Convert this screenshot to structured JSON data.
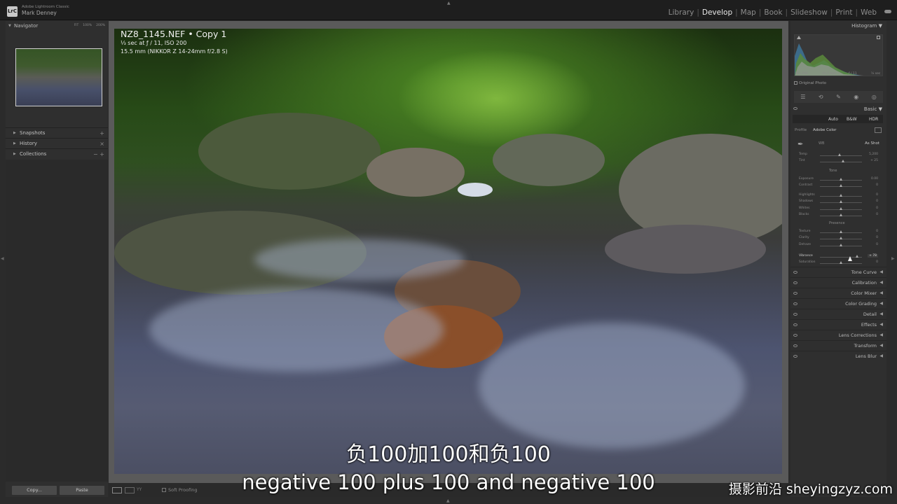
{
  "app": {
    "logo_text": "LrC",
    "app_name": "Adobe Lightroom Classic",
    "user_name": "Mark Denney"
  },
  "modules": [
    "Library",
    "Develop",
    "Map",
    "Book",
    "Slideshow",
    "Print",
    "Web"
  ],
  "active_module": "Develop",
  "left_panel": {
    "navigator": {
      "title": "Navigator",
      "zooms": [
        "FIT",
        "100%",
        "200%"
      ]
    },
    "sections": [
      {
        "label": "Snapshots",
        "control": "+"
      },
      {
        "label": "History",
        "control": "×"
      },
      {
        "label": "Collections",
        "control": "− +"
      }
    ],
    "copy_label": "Copy...",
    "paste_label": "Paste"
  },
  "photo_info": {
    "filename": "NZ8_1145.NEF  •  Copy 1",
    "exposure": "⅓ sec at ƒ / 11, ISO 200",
    "lens": "15.5 mm (NIKKOR Z 14-24mm f/2.8 S)"
  },
  "right_panel": {
    "histogram": {
      "title": "Histogram",
      "info": [
        "ISO 200",
        "15.5 mm",
        "ƒ / 11",
        "⅓ sec"
      ],
      "original_photo": "Original Photo"
    },
    "basic": {
      "title": "Basic",
      "treatments": [
        "Auto",
        "B&W",
        "HDR"
      ],
      "profile_label": "Profile",
      "profile_value": "Adobe Color",
      "wb_label": "WB",
      "wb_value": "As Shot",
      "tone_label": "Tone",
      "presence_label": "Presence",
      "sliders": [
        {
          "label": "Temp",
          "value": "5,200",
          "pos": 0.48
        },
        {
          "label": "Tint",
          "value": "+ 25",
          "pos": 0.55
        },
        {
          "label": "Exposure",
          "value": "0.00",
          "pos": 0.5
        },
        {
          "label": "Contrast",
          "value": "0",
          "pos": 0.5
        },
        {
          "label": "Highlights",
          "value": "0",
          "pos": 0.5
        },
        {
          "label": "Shadows",
          "value": "0",
          "pos": 0.5
        },
        {
          "label": "Whites",
          "value": "0",
          "pos": 0.5
        },
        {
          "label": "Blacks",
          "value": "0",
          "pos": 0.5
        },
        {
          "label": "Texture",
          "value": "0",
          "pos": 0.5
        },
        {
          "label": "Clarity",
          "value": "0",
          "pos": 0.5
        },
        {
          "label": "Dehaze",
          "value": "0",
          "pos": 0.5
        },
        {
          "label": "Vibrance",
          "value": "+ 78",
          "pos": 0.89
        },
        {
          "label": "Saturation",
          "value": "0",
          "pos": 0.5
        }
      ]
    },
    "sections": [
      "Tone Curve",
      "Calibration",
      "Color Mixer",
      "Color Grading",
      "Detail",
      "Effects",
      "Lens Corrections",
      "Transform",
      "Lens Blur"
    ]
  },
  "bottom_toolbar": {
    "view_label": "YY",
    "soft_proofing": "Soft Proofing"
  },
  "subtitles": {
    "cn": "负100加100和负100",
    "en": "negative 100 plus 100 and negative 100"
  },
  "watermark": "摄影前沿 sheyingzyz.com"
}
